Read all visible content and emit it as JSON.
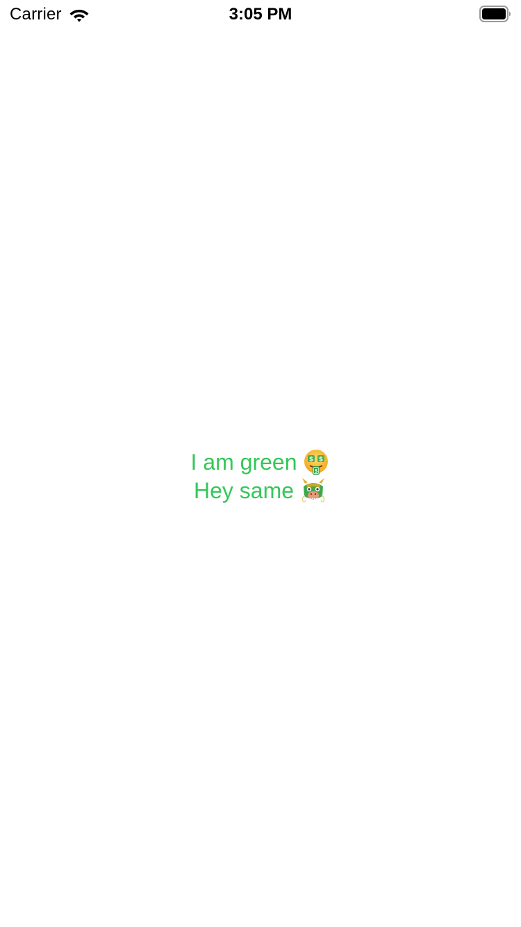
{
  "status_bar": {
    "carrier": "Carrier",
    "time": "3:05 PM",
    "icons": [
      "wifi-icon",
      "battery-icon"
    ]
  },
  "main": {
    "lines": [
      {
        "text": "I am green",
        "emoji": "money-mouth-face-icon"
      },
      {
        "text": "Hey same",
        "emoji": "dragon-face-icon"
      }
    ]
  },
  "colors": {
    "text_green": "#34c759",
    "background": "#ffffff",
    "status_text": "#000000"
  }
}
